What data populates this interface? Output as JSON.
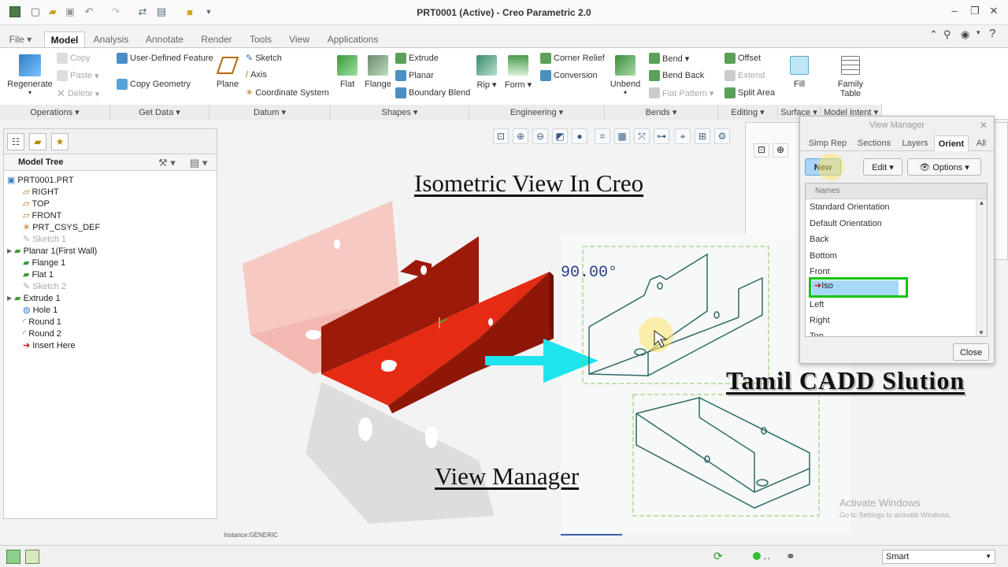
{
  "window": {
    "title": "PRT0001 (Active) - Creo Parametric 2.0"
  },
  "tabs": [
    {
      "label": "File ▾"
    },
    {
      "label": "Model"
    },
    {
      "label": "Analysis"
    },
    {
      "label": "Annotate"
    },
    {
      "label": "Render"
    },
    {
      "label": "Tools"
    },
    {
      "label": "View"
    },
    {
      "label": "Applications"
    }
  ],
  "ribbon": {
    "operations": {
      "regenerate": "Regenerate",
      "copy": "Copy",
      "paste": "Paste",
      "delete": "Delete",
      "group": "Operations ▾"
    },
    "get_data": {
      "udf": "User-Defined Feature",
      "copy_geometry": "Copy Geometry",
      "group": "Get Data ▾"
    },
    "datum": {
      "plane": "Plane",
      "sketch": "Sketch",
      "axis": "Axis",
      "csys": "Coordinate System",
      "group": "Datum ▾"
    },
    "shapes": {
      "flat": "Flat",
      "flange": "Flange",
      "extrude": "Extrude",
      "planar": "Planar",
      "boundary_blend": "Boundary Blend",
      "group": "Shapes ▾"
    },
    "engineering": {
      "rip": "Rip ▾",
      "form": "Form ▾",
      "corner_relief": "Corner Relief",
      "conversion": "Conversion",
      "group": "Engineering ▾"
    },
    "bends": {
      "unbend": "Unbend",
      "bend": "Bend ▾",
      "bend_back": "Bend Back",
      "flat_pattern": "Flat Pattern ▾",
      "group": "Bends ▾"
    },
    "editing": {
      "offset": "Offset",
      "extend": "Extend",
      "split_area": "Split Area",
      "group": "Editing ▾"
    },
    "surface": {
      "fill": "Fill",
      "group": "Surface ▾"
    },
    "model_intent": {
      "family_table": "Family Table",
      "group": "Model Intent ▾"
    }
  },
  "model_tree": {
    "title": "Model Tree",
    "items": [
      {
        "label": "PRT0001.PRT"
      },
      {
        "label": "RIGHT"
      },
      {
        "label": "TOP"
      },
      {
        "label": "FRONT"
      },
      {
        "label": "PRT_CSYS_DEF"
      },
      {
        "label": "Sketch 1"
      },
      {
        "label": "Planar 1(First Wall)"
      },
      {
        "label": "Flange 1"
      },
      {
        "label": "Flat 1"
      },
      {
        "label": "Sketch 2"
      },
      {
        "label": "Extrude 1"
      },
      {
        "label": "Hole 1"
      },
      {
        "label": "Round 1"
      },
      {
        "label": "Round 2"
      },
      {
        "label": "Insert Here"
      }
    ]
  },
  "graphics": {
    "heading": "Isometric View In Creo",
    "subheading": "View Manager",
    "brand": "Tamil CADD Slution",
    "dim_value": "90.00°",
    "instance": "Instance:GENERIC",
    "activate_line1": "Activate Windows",
    "activate_line2": "Go to Settings to activate Windows."
  },
  "view_manager": {
    "title": "View Manager",
    "tabs": [
      {
        "label": "Simp Rep"
      },
      {
        "label": "Sections"
      },
      {
        "label": "Layers"
      },
      {
        "label": "Orient"
      },
      {
        "label": "All"
      }
    ],
    "new_label": "New",
    "edit_label": "Edit ▾",
    "options_label": "Options ▾",
    "names_header": "Names",
    "items": [
      {
        "label": "Standard Orientation"
      },
      {
        "label": "Default Orientation"
      },
      {
        "label": "Back"
      },
      {
        "label": "Bottom"
      },
      {
        "label": "Front"
      },
      {
        "label": "Iso"
      },
      {
        "label": "Left"
      },
      {
        "label": "Right"
      },
      {
        "label": "Top"
      }
    ],
    "close_label": "Close"
  },
  "status": {
    "filter": "Smart"
  },
  "colors": {
    "part_red": "#e52b14",
    "part_dark": "#8f1708",
    "highlight_green": "#12c412",
    "arrow_cyan": "#1ee4ee",
    "iso_selected": "#a8d8f8"
  }
}
